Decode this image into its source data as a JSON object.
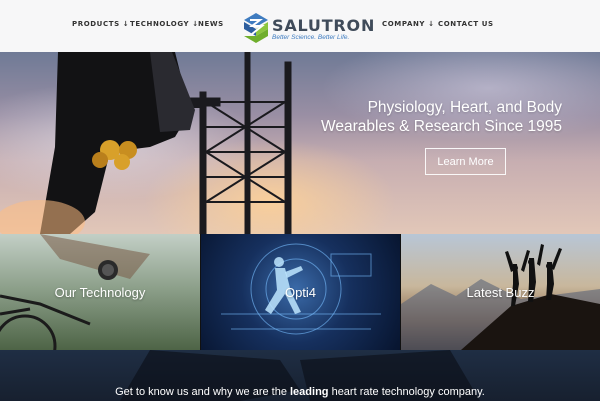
{
  "nav": {
    "products": "PRODUCTS ↓",
    "technology": "TECHNOLOGY ↓",
    "news": "NEWS",
    "company": "COMPANY ↓",
    "contact": "CONTACT US"
  },
  "logo": {
    "name": "SALUTRON",
    "tagline": "Better Science. Better Life."
  },
  "hero": {
    "title_line1": "Physiology, Heart, and Body",
    "title_line2": "Wearables & Research Since 1995",
    "cta": "Learn More"
  },
  "tiles": [
    {
      "label": "Our Technology"
    },
    {
      "label": "Opti4"
    },
    {
      "label": "Latest Buzz"
    }
  ],
  "footer_banner": {
    "before": "Get to know us and why we are the ",
    "bold": "leading",
    "after": " heart rate technology company."
  },
  "colors": {
    "header_bg": "#f7f7f8",
    "logo_blue": "#3f7cc0",
    "logo_green": "#8cc63f",
    "logo_text": "#3f4b5a"
  }
}
